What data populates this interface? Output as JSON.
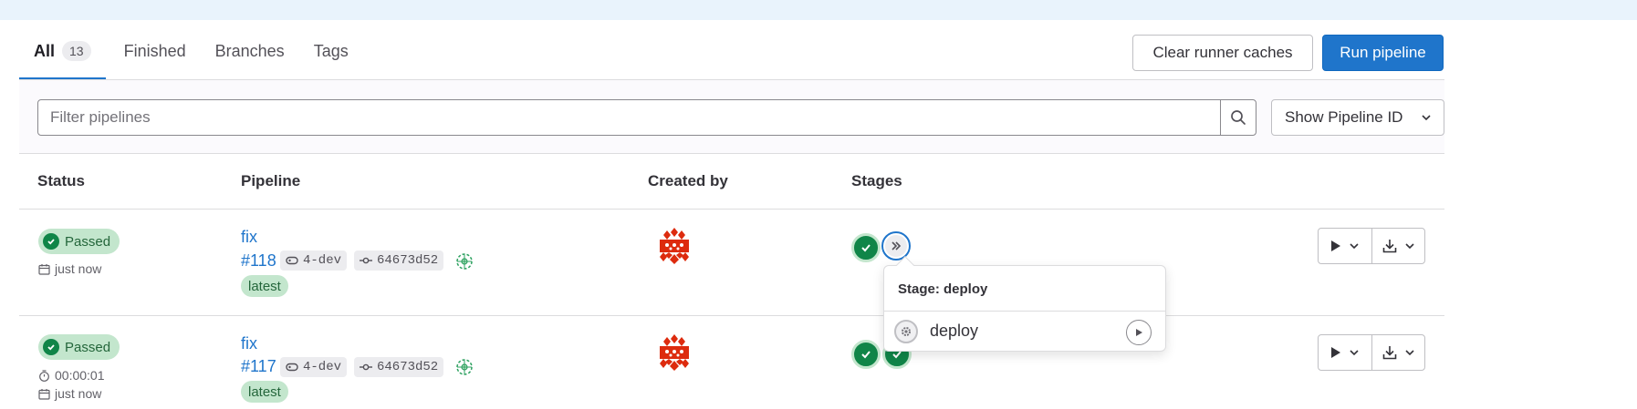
{
  "tabs": [
    {
      "label": "All",
      "count": "13"
    },
    {
      "label": "Finished"
    },
    {
      "label": "Branches"
    },
    {
      "label": "Tags"
    }
  ],
  "buttons": {
    "clear_caches": "Clear runner caches",
    "run_pipeline": "Run pipeline",
    "show_pipeline_id": "Show Pipeline ID"
  },
  "filter": {
    "placeholder": "Filter pipelines"
  },
  "table": {
    "headers": {
      "status": "Status",
      "pipeline": "Pipeline",
      "created_by": "Created by",
      "stages": "Stages"
    },
    "rows": [
      {
        "status": "Passed",
        "finished": "just now",
        "commit_title": "fix",
        "pipeline_id": "#118",
        "ref": "4-dev",
        "sha": "64673d52",
        "tag": "latest"
      },
      {
        "status": "Passed",
        "duration": "00:00:01",
        "finished": "just now",
        "commit_title": "fix",
        "pipeline_id": "#117",
        "ref": "4-dev",
        "sha": "64673d52",
        "tag": "latest"
      }
    ]
  },
  "popover": {
    "title": "Stage: deploy",
    "job_name": "deploy"
  },
  "colors": {
    "accent": "#1f75cb",
    "success": "#108548",
    "success_bg": "#c3e6cd",
    "avatar": "#dd2b0e"
  }
}
